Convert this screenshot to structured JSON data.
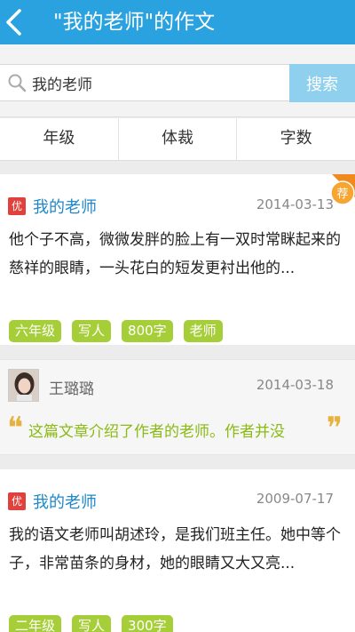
{
  "header": {
    "title": "\"我的老师\"的作文"
  },
  "search": {
    "value": "我的老师",
    "button_label": "搜索"
  },
  "filters": [
    {
      "label": "年级"
    },
    {
      "label": "体裁"
    },
    {
      "label": "字数"
    }
  ],
  "essays": [
    {
      "badge": "优",
      "title": "我的老师",
      "date": "2014-03-13",
      "ribbon": "荐",
      "excerpt": "他个子不高，微微发胖的脸上有一双时常眯起来的慈祥的眼睛，一头花白的短发更衬出他的...",
      "tags": [
        "六年级",
        "写人",
        "800字",
        "老师"
      ]
    },
    {
      "badge": "优",
      "title": "我的老师",
      "date": "2009-07-17",
      "excerpt": "我的语文老师叫胡述玲，是我们班主任。她中等个子，非常苗条的身材，她的眼睛又大又亮...",
      "tags": [
        "二年级",
        "写人",
        "300字"
      ]
    }
  ],
  "comment": {
    "name": "王璐璐",
    "date": "2014-03-18",
    "text": "这篇文章介绍了作者的老师。作者并没",
    "quote_open": "❝",
    "quote_close": "❞"
  },
  "colors": {
    "header": "#2aa2e0",
    "title_link": "#1e88c8",
    "tag": "#a6ce39",
    "badge": "#e0413c",
    "ribbon": "#f08a1d",
    "comment_text": "#8aba14"
  }
}
